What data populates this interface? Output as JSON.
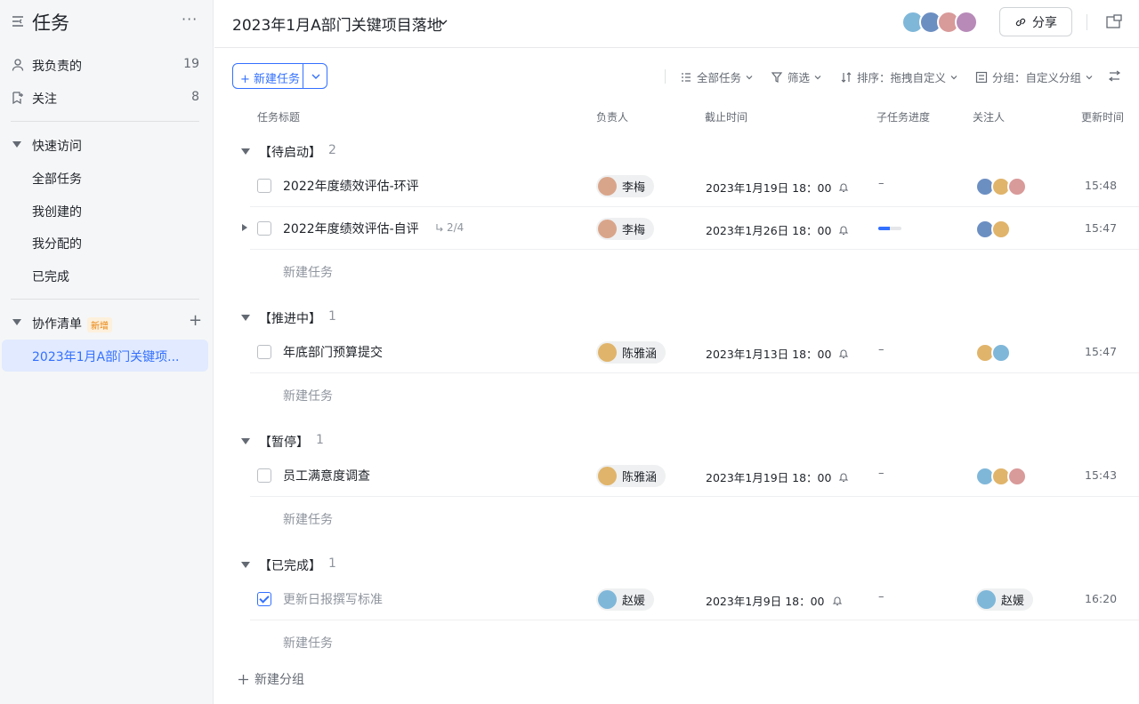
{
  "sidebar": {
    "title": "任务",
    "more": "···",
    "items": [
      {
        "label": "我负责的",
        "count": "19"
      },
      {
        "label": "关注",
        "count": "8"
      }
    ],
    "quick_access": {
      "label": "快速访问",
      "items": [
        "全部任务",
        "我创建的",
        "我分配的",
        "已完成"
      ]
    },
    "collab": {
      "label": "协作清单",
      "badge": "新增",
      "plus": "+",
      "active_item": "2023年1月A部门关键项..."
    }
  },
  "header": {
    "title": "2023年1月A部门关键项目落地",
    "share_label": "分享"
  },
  "toolbar": {
    "new_task_label": "+ 新建任务",
    "filters": [
      {
        "label": "全部任务",
        "icon": "list-filter-icon"
      },
      {
        "label": "筛选",
        "icon": "funnel-icon"
      },
      {
        "label": "排序：拖拽自定义",
        "icon": "sort-icon"
      },
      {
        "label": "分组：自定义分组",
        "icon": "group-icon"
      }
    ]
  },
  "columns": [
    "任务标题",
    "负责人",
    "截止时间",
    "子任务进度",
    "关注人",
    "更新时间"
  ],
  "groups": [
    {
      "name": "【待启动】",
      "count": "2",
      "tasks": [
        {
          "title": "2022年度绩效评估-环评",
          "assignee": "李梅",
          "due": "2023年1月19日 18：00",
          "progress": "–",
          "updated": "15:48",
          "done": false
        },
        {
          "title": "2022年度绩效评估-自评",
          "subtasks": "2/4",
          "assignee": "李梅",
          "due": "2023年1月26日 18：00",
          "progress_fraction": 0.5,
          "updated": "15:47",
          "done": false
        }
      ]
    },
    {
      "name": "【推进中】",
      "count": "1",
      "tasks": [
        {
          "title": "年底部门预算提交",
          "assignee": "陈雅涵",
          "due": "2023年1月13日 18：00",
          "progress": "–",
          "updated": "15:47",
          "done": false
        }
      ]
    },
    {
      "name": "【暂停】",
      "count": "1",
      "tasks": [
        {
          "title": "员工满意度调查",
          "assignee": "陈雅涵",
          "due": "2023年1月19日 18：00",
          "progress": "–",
          "updated": "15:43",
          "done": false
        }
      ]
    },
    {
      "name": "【已完成】",
      "count": "1",
      "tasks": [
        {
          "title": "更新日报撰写标准",
          "assignee": "赵媛",
          "due": "2023年1月9日 18：00",
          "progress": "–",
          "follower_label": "赵媛",
          "updated": "16:20",
          "done": true
        }
      ]
    }
  ],
  "new_task_label": "新建任务",
  "new_group_label": "新建分组",
  "colors": {
    "accent": "#3370ff",
    "sidebar_bg": "#f5f6f7",
    "active_bg": "#e1eaff"
  }
}
